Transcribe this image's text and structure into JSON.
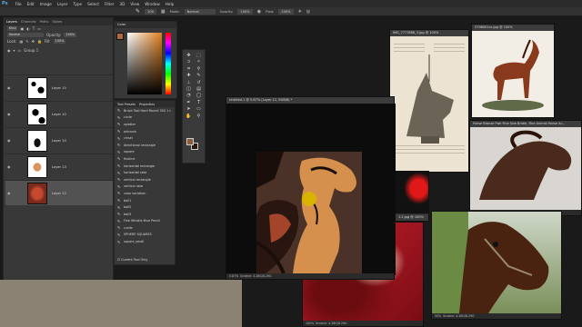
{
  "app": {
    "logo": "Ps"
  },
  "menu": [
    "File",
    "Edit",
    "Image",
    "Layer",
    "Type",
    "Select",
    "Filter",
    "3D",
    "View",
    "Window",
    "Help"
  ],
  "options": {
    "brush_size": "100",
    "mode_label": "Mode:",
    "mode_value": "Normal",
    "opacity_label": "Opacity:",
    "opacity_value": "100%",
    "flow_label": "Flow:",
    "flow_value": "100%"
  },
  "layers_panel": {
    "tabs": [
      "Layers",
      "Channels",
      "Paths",
      "Styles"
    ],
    "kind": "Kind",
    "blend": "Normal",
    "opacity_label": "Opacity:",
    "opacity_value": "100%",
    "lock_label": "Lock:",
    "fill_label": "Fill:",
    "fill_value": "100%",
    "group_name": "Group 1",
    "layers": [
      {
        "name": "Layer 15"
      },
      {
        "name": "Layer 10"
      },
      {
        "name": "Layer 14"
      },
      {
        "name": "Layer 13"
      },
      {
        "name": "Layer 12"
      }
    ],
    "footer_icons": [
      "link-icon",
      "fx-icon",
      "mask-icon",
      "adjustment-icon",
      "folder-icon",
      "new-layer-icon",
      "trash-icon"
    ]
  },
  "color_panel": {
    "title": "Color",
    "foreground": "#b06a3c"
  },
  "presets_panel": {
    "tabs": [
      "Tool Presets",
      "Properties"
    ],
    "items": [
      "Brush Tool Hard Round 300 1 c",
      "circle",
      "splatter",
      "airbrush",
      "chisel",
      "directional rectangle",
      "square",
      "finaline",
      "horizontal rectangle",
      "horizontal rake",
      "vertical rectangle",
      "vertical rake",
      "color variation",
      "ball1",
      "ball2",
      "ball3",
      "Fine Whistle Blue Pencil",
      "curde",
      "SPHERE SQUARES",
      "square_small"
    ],
    "footer": "Current Tool Only"
  },
  "documents": {
    "main": {
      "title": "Untitled-1 @ 5.87% (Layer 12, RGB/8) *",
      "status": "5.87%",
      "status_doc": "Scratch: 4.28G/8.29G"
    },
    "book": {
      "title": "IMG_7777888_3.jpg @ 100%"
    },
    "brownhorse": {
      "title": "5798001cc.jpg @ 100%"
    },
    "bronze": {
      "title": "Horse Bronze Fwk Fine Size Bridle, Fine Animal Horse Ar...",
      "status": "50%",
      "status_doc": "Scratch: 4.28G/8.29G"
    },
    "bayhorse": {
      "status": "50%",
      "status_doc": "Scratch: 4.28G/8.29G"
    },
    "redwin": {
      "title": "1.2.jpg @ 100%"
    },
    "redart": {
      "status": "100%",
      "status_doc": "Scratch: 4.28G/8.29G"
    }
  }
}
